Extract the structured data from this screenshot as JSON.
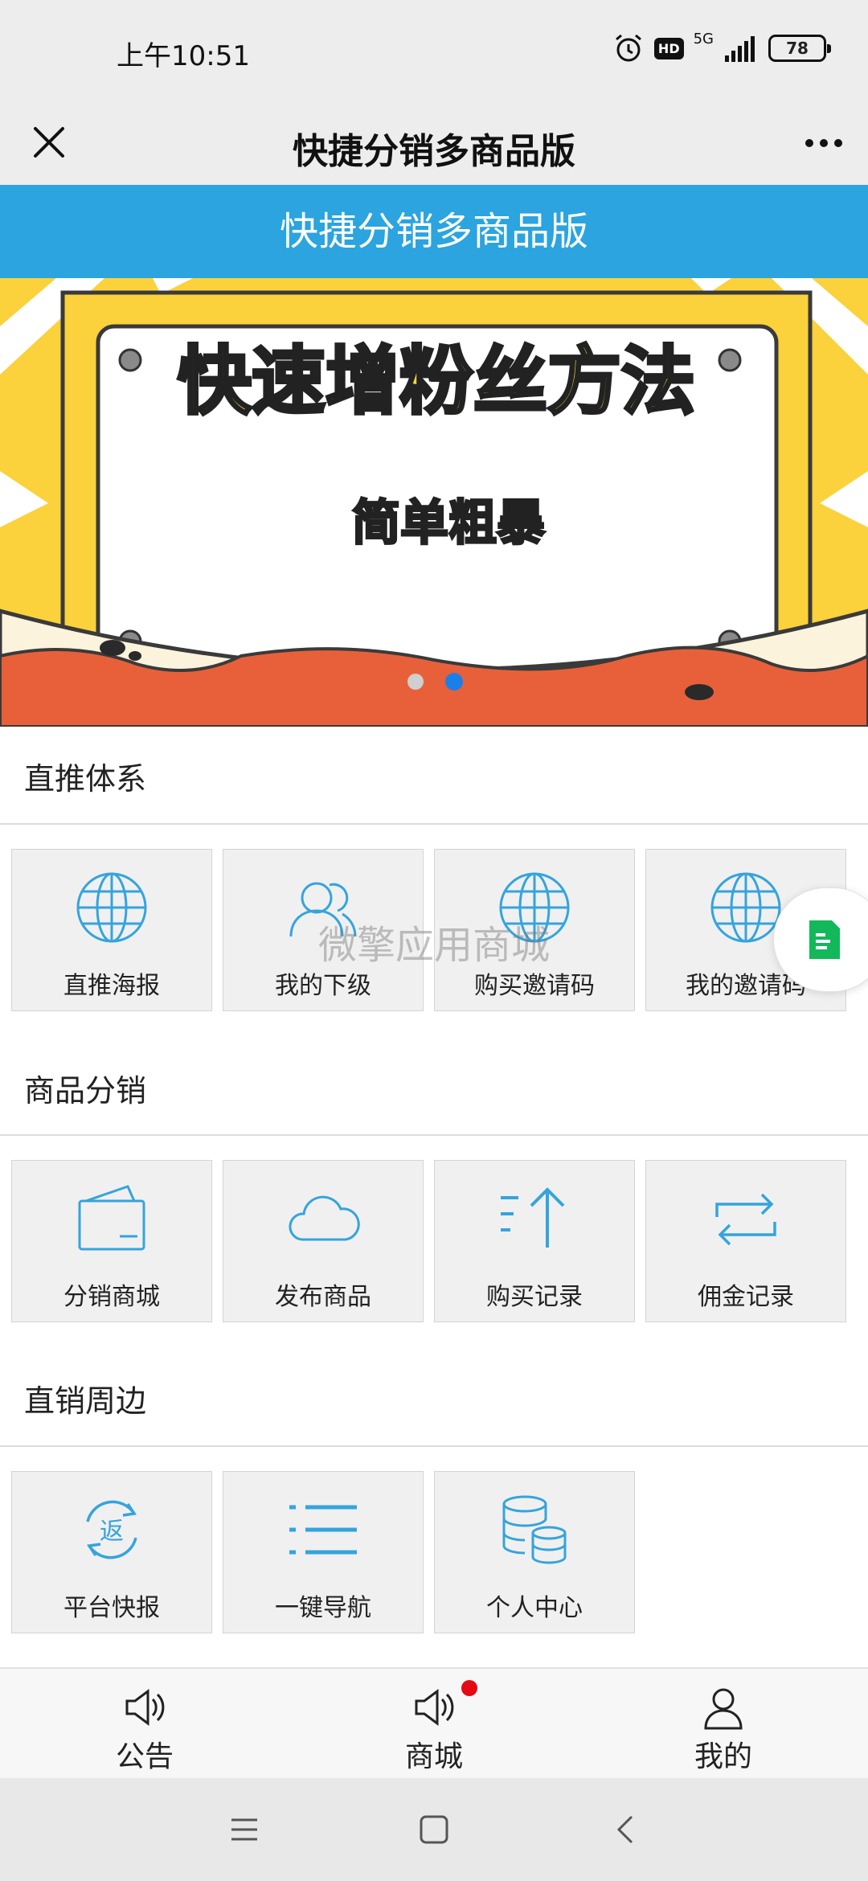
{
  "status_bar": {
    "time": "上午10:51",
    "hd_badge": "HD",
    "network": "5G",
    "battery": "78"
  },
  "title_bar": {
    "title": "快捷分销多商品版"
  },
  "header": {
    "title": "快捷分销多商品版"
  },
  "banner": {
    "headline": "快速增粉丝方法",
    "subline": "简单粗暴",
    "pages": 2,
    "active_page": 2
  },
  "sections": [
    {
      "title": "直推体系",
      "items": [
        {
          "label": "直推海报",
          "icon": "globe-icon"
        },
        {
          "label": "我的下级",
          "icon": "users-icon"
        },
        {
          "label": "购买邀请码",
          "icon": "globe-icon"
        },
        {
          "label": "我的邀请码",
          "icon": "globe-icon"
        }
      ]
    },
    {
      "title": "商品分销",
      "items": [
        {
          "label": "分销商城",
          "icon": "wallet-icon"
        },
        {
          "label": "发布商品",
          "icon": "cloud-icon"
        },
        {
          "label": "购买记录",
          "icon": "sort-up-icon"
        },
        {
          "label": "佣金记录",
          "icon": "exchange-icon"
        }
      ]
    },
    {
      "title": "直销周边",
      "items": [
        {
          "label": "平台快报",
          "icon": "refund-icon"
        },
        {
          "label": "一键导航",
          "icon": "list-icon"
        },
        {
          "label": "个人中心",
          "icon": "database-icon"
        }
      ]
    }
  ],
  "watermark": "微擎应用商城",
  "tabs": [
    {
      "label": "公告",
      "icon": "speaker-icon"
    },
    {
      "label": "商城",
      "icon": "speaker-icon",
      "badge": true
    },
    {
      "label": "我的",
      "icon": "user-icon"
    }
  ],
  "colors": {
    "accent": "#2ba4df",
    "icon": "#35a4dc",
    "badge": "#e50914",
    "float": "#12b85a"
  }
}
